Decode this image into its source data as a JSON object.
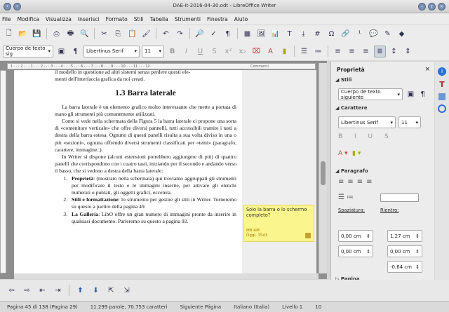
{
  "window": {
    "title": "DAE-it-2016-04-30.odt - LibreOffice Writer"
  },
  "menu": [
    "File",
    "Modifica",
    "Visualizza",
    "Inserisci",
    "Formato",
    "Stili",
    "Tabella",
    "Strumenti",
    "Finestra",
    "Aiuto"
  ],
  "format": {
    "style": "Cuerpo de texto sig",
    "font": "Libertinus Serif",
    "size": "11"
  },
  "ruler": {
    "ticks": "1 · · · 2 · · · 1 · · · 2 · · · 3 · · · 4 · · · 5 · · · 6 · · · 7 · · · 8 · · · 9 · · · 10 · · · 11 · · · 12",
    "comments": "Commenti"
  },
  "document": {
    "line_top": "il modello in questione ad altri sistemi senza perdere questi ele-",
    "line_top2": "menti dell'interfaccia grafica da noi creati.",
    "heading": "1.3 Barra laterale",
    "p1": "La barra laterale è un elemento grafico molto interessante che mette a portata di mano gli strumenti più comunemente utilizzati.",
    "p2": "Come si vede nella schermata della Figura 5 la barra laterale ci propone una sorta di «contenitore verticale» che offre diversi pannelli, tutti accessibili tramite i tasti a destra della barra estesa. Ognuno di questi panelli risulta a sua volta diviso in una o più «sezioni», ognuna offrendo diversi strumenti classificati per «temi» (paragrafo, carattere, immagine..).",
    "p3": "In Writer si dispone (alcuni estensioni potrebbero aggiungere di più) di quattro panelli che corrispondono con i cuatro tasti, iniziando per il secondo e andando verso il basso, che si vedono a destra della barra laterale:",
    "li1_b": "Proprietà",
    "li1": ": (mostrato nella schermata) qui troviamo aggruppati gli strumenti per modificare il testo e le immagini inserite, per attivare gli elenchi numerati o puntati, gli oggetti grafici, eccetera.",
    "li2_b": "Stili e formattazione",
    "li2": ": lo strumento per gestire gli stili in Writer. Torneremo su questo a partire della pagina 49.",
    "li3_b": "La Galleria",
    "li3": ": LibO offre un gran numero di immagini pronte da inserire in qualsiasi documento. Parleremo su questo a pagina 92."
  },
  "comment": {
    "text": "Solo la barra o lo schermo completo?",
    "author": "MB RM",
    "date": "Oggi, 1543"
  },
  "sidebar": {
    "title": "Proprietà",
    "stili": "Stili",
    "style_value": "Cuerpo de texto siguiente",
    "carattere": "Carattere",
    "font_value": "Libertinus Serif",
    "size_value": "11",
    "paragrafo": "Paragrafo",
    "spaziatura": "Spaziatura:",
    "rientro": "Rientro:",
    "sp1": "0,00 cm",
    "sp2": "0,00 cm",
    "ri1": "1,27 cm",
    "ri2": "0,00 cm",
    "ri3": "-0,64 cm",
    "pagina": "Pagina"
  },
  "status": {
    "page": "Pagina 45 di 138 (Pagina 29)",
    "words": "11.299 parole, 70.753 caratteri",
    "style": "Siguiente Página",
    "lang": "Italiano (Italia)",
    "level": "Livello 1",
    "zoom": "10"
  }
}
